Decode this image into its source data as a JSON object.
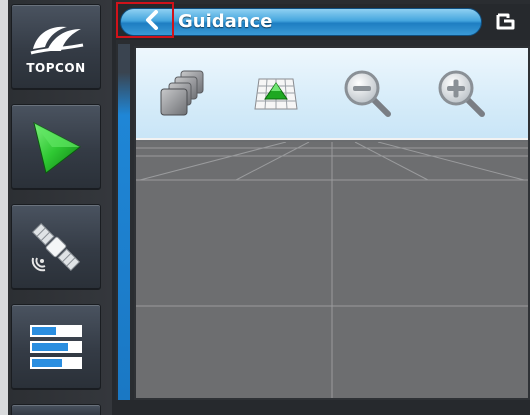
{
  "sidebar": {
    "logo_text": "TOPCON",
    "buttons": [
      {
        "icon": "topcon-logo-icon"
      },
      {
        "icon": "play-triangle-icon",
        "color": "#2ec832"
      },
      {
        "icon": "satellite-icon"
      },
      {
        "icon": "settings-bars-icon",
        "color": "#2a8ee0"
      }
    ]
  },
  "header": {
    "title": "Guidance",
    "back_icon": "chevron-left-icon",
    "window_icon": "window-toggle-icon",
    "accent": "#3a9ad6",
    "highlight_border": "#d0121a"
  },
  "toolbar": {
    "tools": [
      {
        "icon": "layers-icon"
      },
      {
        "icon": "field-map-icon"
      },
      {
        "icon": "zoom-out-icon"
      },
      {
        "icon": "zoom-in-icon"
      }
    ]
  }
}
